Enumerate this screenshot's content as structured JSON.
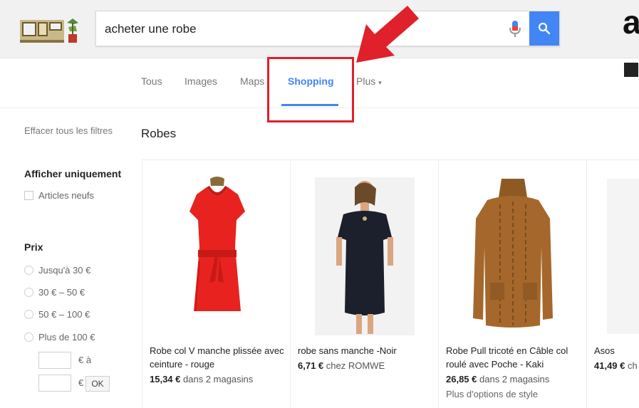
{
  "search": {
    "query": "acheter une robe"
  },
  "tabs": [
    {
      "label": "Tous"
    },
    {
      "label": "Images"
    },
    {
      "label": "Maps"
    },
    {
      "label": "Shopping"
    },
    {
      "label": "Plus"
    }
  ],
  "sidebar": {
    "clear_filters": "Effacer tous les filtres",
    "show_only": {
      "heading": "Afficher uniquement",
      "option": "Articles neufs"
    },
    "price": {
      "heading": "Prix",
      "options": [
        "Jusqu'à 30 €",
        "30 € – 50 €",
        "50 € – 100 €",
        "Plus de 100 €"
      ],
      "from_unit": "€ à",
      "to_unit": "€",
      "ok_label": "OK"
    }
  },
  "results": {
    "title": "Robes",
    "products": [
      {
        "title": "Robe col V manche plissée avec ceinture - rouge",
        "price": "15,34 €",
        "seller": "dans 2 magasins"
      },
      {
        "title": "robe sans manche -Noir",
        "price": "6,71 €",
        "seller": "chez ROMWE"
      },
      {
        "title": "Robe Pull tricoté en Câble col roulé avec Poche - Kaki",
        "price": "26,85 €",
        "seller": "dans 2 magasins",
        "extra": "Plus d'options de style"
      },
      {
        "title": "Asos",
        "price": "41,49 €",
        "seller": "ch"
      }
    ]
  },
  "colors": {
    "accent": "#4285f4",
    "highlight": "#e0202a"
  },
  "icons": [
    "logo-doodle",
    "mic-icon",
    "search-icon",
    "chevron-down-icon",
    "arrow-annotation"
  ]
}
